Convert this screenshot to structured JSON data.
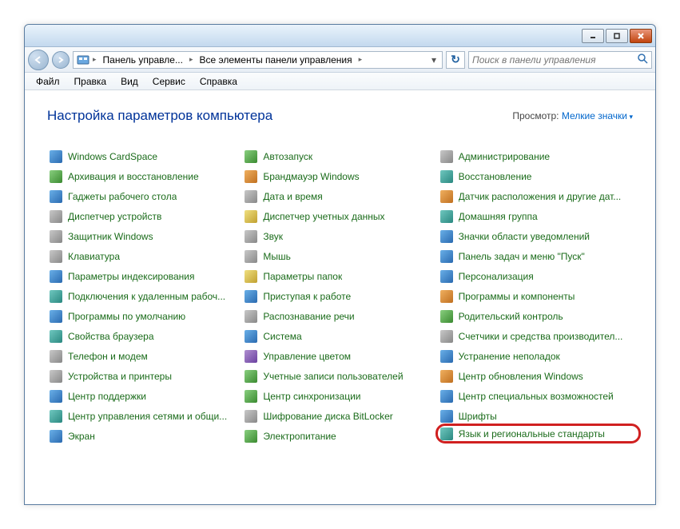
{
  "titlebar": {
    "min": "—",
    "max": "▢",
    "close": "✕"
  },
  "nav": {
    "crumb1": "Панель управле...",
    "crumb2": "Все элементы панели управления",
    "refresh": "↻"
  },
  "search": {
    "placeholder": "Поиск в панели управления"
  },
  "menu": {
    "file": "Файл",
    "edit": "Правка",
    "view": "Вид",
    "tools": "Сервис",
    "help": "Справка"
  },
  "header": {
    "title": "Настройка параметров компьютера",
    "viewby_label": "Просмотр:",
    "viewby_value": "Мелкие значки"
  },
  "items": {
    "c0": "Windows CardSpace",
    "c1": "Автозапуск",
    "c2": "Администрирование",
    "c3": "Архивация и восстановление",
    "c4": "Брандмауэр Windows",
    "c5": "Восстановление",
    "c6": "Гаджеты рабочего стола",
    "c7": "Дата и время",
    "c8": "Датчик расположения и другие дат...",
    "c9": "Диспетчер устройств",
    "c10": "Диспетчер учетных данных",
    "c11": "Домашняя группа",
    "c12": "Защитник Windows",
    "c13": "Звук",
    "c14": "Значки области уведомлений",
    "c15": "Клавиатура",
    "c16": "Мышь",
    "c17": "Панель задач и меню \"Пуск\"",
    "c18": "Параметры индексирования",
    "c19": "Параметры папок",
    "c20": "Персонализация",
    "c21": "Подключения к удаленным рабоч...",
    "c22": "Приступая к работе",
    "c23": "Программы и компоненты",
    "c24": "Программы по умолчанию",
    "c25": "Распознавание речи",
    "c26": "Родительский контроль",
    "c27": "Свойства браузера",
    "c28": "Система",
    "c29": "Счетчики и средства производител...",
    "c30": "Телефон и модем",
    "c31": "Управление цветом",
    "c32": "Устранение неполадок",
    "c33": "Устройства и принтеры",
    "c34": "Учетные записи пользователей",
    "c35": "Центр обновления Windows",
    "c36": "Центр поддержки",
    "c37": "Центр синхронизации",
    "c38": "Центр специальных возможностей",
    "c39": "Центр управления сетями и общи...",
    "c40": "Шифрование диска BitLocker",
    "c41": "Шрифты",
    "c42": "Экран",
    "c43": "Электропитание",
    "c44": "Язык и региональные стандарты"
  }
}
